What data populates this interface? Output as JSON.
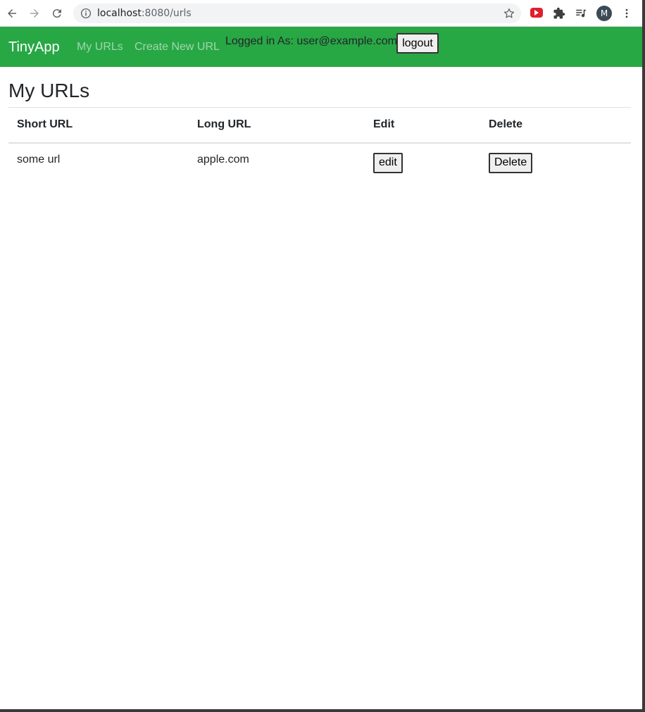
{
  "browser": {
    "url_host": "localhost",
    "url_rest": ":8080/urls",
    "profile_initial": "M"
  },
  "nav": {
    "brand": "TinyApp",
    "links": [
      "My URLs",
      "Create New URL"
    ],
    "logged_in_text": "Logged in As: user@example.com",
    "logout_label": "logout"
  },
  "main": {
    "title": "My URLs",
    "columns": [
      "Short URL",
      "Long URL",
      "Edit",
      "Delete"
    ],
    "rows": [
      {
        "short_url": "some url",
        "long_url": "apple.com",
        "edit_label": "edit",
        "delete_label": "Delete"
      }
    ]
  },
  "colors": {
    "navbar": "#28a745",
    "text": "#212529"
  }
}
